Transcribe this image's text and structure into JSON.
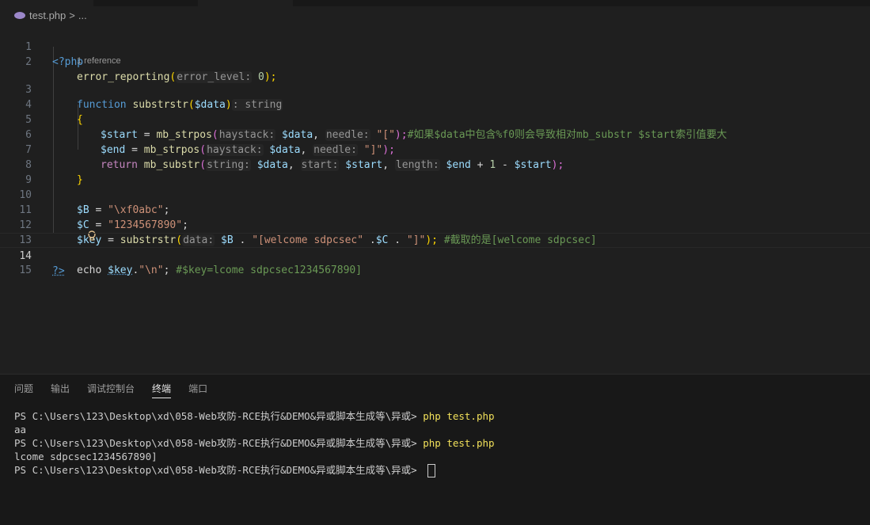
{
  "breadcrumb": {
    "file": "test.php",
    "separator": ">",
    "more": "..."
  },
  "editor": {
    "codelens": "1 reference",
    "line_numbers": [
      "1",
      "2",
      "3",
      "4",
      "5",
      "6",
      "7",
      "8",
      "9",
      "10",
      "11",
      "12",
      "13",
      "14",
      "15"
    ],
    "lines": {
      "l1": [
        "<?php"
      ],
      "l2": [
        "error_reporting",
        "(",
        "error_level:",
        "0",
        ");"
      ],
      "l3": [
        "function",
        "substrstr",
        "(",
        "$data",
        ")",
        ": string"
      ],
      "l4": [
        "{"
      ],
      "l5": [
        "$start",
        " = ",
        "mb_strpos",
        "(",
        "haystack:",
        "$data",
        ", ",
        "needle:",
        "\"[\"",
        ");",
        "#如果$data中包含%f0则会导致相对mb_substr $start索引值要大"
      ],
      "l6": [
        "$end",
        " = ",
        "mb_strpos",
        "(",
        "haystack:",
        "$data",
        ", ",
        "needle:",
        "\"]\"",
        ");"
      ],
      "l7": [
        "return",
        "mb_substr",
        "(",
        "string:",
        "$data",
        ", ",
        "start:",
        "$start",
        ", ",
        "length:",
        "$end",
        " + ",
        "1",
        " - ",
        "$start",
        ");"
      ],
      "l8": [
        "}"
      ],
      "l10": [
        "$B",
        " = ",
        "\"\\xf0abc\"",
        ";"
      ],
      "l11": [
        "$C",
        " = ",
        "\"1234567890\"",
        ";"
      ],
      "l12": [
        "$key",
        " = ",
        "substrstr",
        "(",
        "data:",
        "$B",
        " . ",
        "\"[welcome sdpcsec\"",
        " .",
        "$C",
        " . ",
        "\"]\"",
        ");",
        "#截取的是[welcome sdpcsec]"
      ],
      "l13": [
        "echo",
        "$key",
        ".",
        "\"\\n\"",
        ";",
        "#$key=lcome sdpcsec1234567890]"
      ],
      "l14": [
        "?>"
      ]
    }
  },
  "panel": {
    "tabs": [
      "问题",
      "输出",
      "调试控制台",
      "终端",
      "端口"
    ],
    "active_tab": "终端",
    "terminal": {
      "prompt": "PS C:\\Users\\123\\Desktop\\xd\\058-Web攻防-RCE执行&DEMO&异或脚本生成等\\异或> ",
      "cmd1": "php test.php",
      "out1": "aa",
      "cmd2": "php test.php",
      "out2": "lcome sdpcsec1234567890]"
    }
  },
  "colors": {
    "background": "#1f1f1f",
    "panel": "#181818",
    "keyword": "#569cd6",
    "function": "#dcdcaa",
    "variable": "#9cdcfe",
    "string": "#ce9178",
    "comment": "#6a9955",
    "number": "#b5cea8",
    "bracket_gold": "#ffd700",
    "bracket_purple": "#da70d6",
    "bracket_blue": "#179fff"
  },
  "icons": [
    "php-elephant-icon",
    "chevron-right-icon",
    "lightbulb-icon"
  ]
}
